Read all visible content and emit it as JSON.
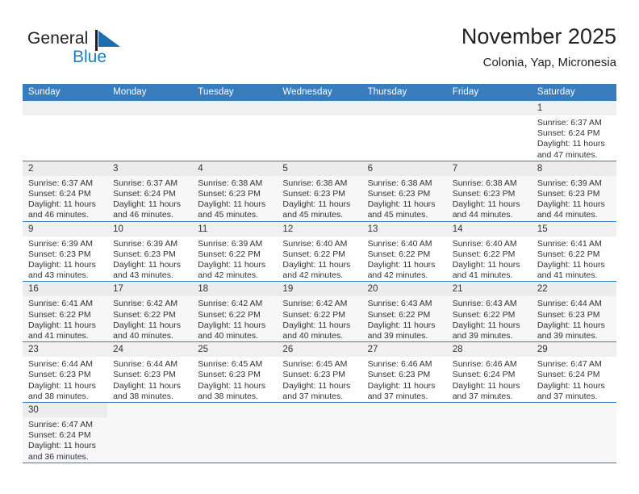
{
  "logo": {
    "word1": "General",
    "word2": "Blue",
    "flag_icon": "blue-triangle-flag",
    "color_dark": "#231f20",
    "color_blue": "#1b7fc4"
  },
  "header": {
    "title": "November 2025",
    "subtitle": "Colonia, Yap, Micronesia"
  },
  "theme": {
    "header_bg": "#3a7dbe",
    "header_text": "#ffffff",
    "daynum_bg": "#f0f0f0",
    "row_alt_bg": "#f7f7f7",
    "grid_line": "#3a7dbe"
  },
  "weekday_headers": [
    "Sunday",
    "Monday",
    "Tuesday",
    "Wednesday",
    "Thursday",
    "Friday",
    "Saturday"
  ],
  "weeks": [
    [
      {
        "day": "",
        "empty": true
      },
      {
        "day": "",
        "empty": true
      },
      {
        "day": "",
        "empty": true
      },
      {
        "day": "",
        "empty": true
      },
      {
        "day": "",
        "empty": true
      },
      {
        "day": "",
        "empty": true
      },
      {
        "day": "1",
        "sunrise": "Sunrise: 6:37 AM",
        "sunset": "Sunset: 6:24 PM",
        "daylight1": "Daylight: 11 hours",
        "daylight2": "and 47 minutes."
      }
    ],
    [
      {
        "day": "2",
        "sunrise": "Sunrise: 6:37 AM",
        "sunset": "Sunset: 6:24 PM",
        "daylight1": "Daylight: 11 hours",
        "daylight2": "and 46 minutes."
      },
      {
        "day": "3",
        "sunrise": "Sunrise: 6:37 AM",
        "sunset": "Sunset: 6:24 PM",
        "daylight1": "Daylight: 11 hours",
        "daylight2": "and 46 minutes."
      },
      {
        "day": "4",
        "sunrise": "Sunrise: 6:38 AM",
        "sunset": "Sunset: 6:23 PM",
        "daylight1": "Daylight: 11 hours",
        "daylight2": "and 45 minutes."
      },
      {
        "day": "5",
        "sunrise": "Sunrise: 6:38 AM",
        "sunset": "Sunset: 6:23 PM",
        "daylight1": "Daylight: 11 hours",
        "daylight2": "and 45 minutes."
      },
      {
        "day": "6",
        "sunrise": "Sunrise: 6:38 AM",
        "sunset": "Sunset: 6:23 PM",
        "daylight1": "Daylight: 11 hours",
        "daylight2": "and 45 minutes."
      },
      {
        "day": "7",
        "sunrise": "Sunrise: 6:38 AM",
        "sunset": "Sunset: 6:23 PM",
        "daylight1": "Daylight: 11 hours",
        "daylight2": "and 44 minutes."
      },
      {
        "day": "8",
        "sunrise": "Sunrise: 6:39 AM",
        "sunset": "Sunset: 6:23 PM",
        "daylight1": "Daylight: 11 hours",
        "daylight2": "and 44 minutes."
      }
    ],
    [
      {
        "day": "9",
        "sunrise": "Sunrise: 6:39 AM",
        "sunset": "Sunset: 6:23 PM",
        "daylight1": "Daylight: 11 hours",
        "daylight2": "and 43 minutes."
      },
      {
        "day": "10",
        "sunrise": "Sunrise: 6:39 AM",
        "sunset": "Sunset: 6:23 PM",
        "daylight1": "Daylight: 11 hours",
        "daylight2": "and 43 minutes."
      },
      {
        "day": "11",
        "sunrise": "Sunrise: 6:39 AM",
        "sunset": "Sunset: 6:22 PM",
        "daylight1": "Daylight: 11 hours",
        "daylight2": "and 42 minutes."
      },
      {
        "day": "12",
        "sunrise": "Sunrise: 6:40 AM",
        "sunset": "Sunset: 6:22 PM",
        "daylight1": "Daylight: 11 hours",
        "daylight2": "and 42 minutes."
      },
      {
        "day": "13",
        "sunrise": "Sunrise: 6:40 AM",
        "sunset": "Sunset: 6:22 PM",
        "daylight1": "Daylight: 11 hours",
        "daylight2": "and 42 minutes."
      },
      {
        "day": "14",
        "sunrise": "Sunrise: 6:40 AM",
        "sunset": "Sunset: 6:22 PM",
        "daylight1": "Daylight: 11 hours",
        "daylight2": "and 41 minutes."
      },
      {
        "day": "15",
        "sunrise": "Sunrise: 6:41 AM",
        "sunset": "Sunset: 6:22 PM",
        "daylight1": "Daylight: 11 hours",
        "daylight2": "and 41 minutes."
      }
    ],
    [
      {
        "day": "16",
        "sunrise": "Sunrise: 6:41 AM",
        "sunset": "Sunset: 6:22 PM",
        "daylight1": "Daylight: 11 hours",
        "daylight2": "and 41 minutes."
      },
      {
        "day": "17",
        "sunrise": "Sunrise: 6:42 AM",
        "sunset": "Sunset: 6:22 PM",
        "daylight1": "Daylight: 11 hours",
        "daylight2": "and 40 minutes."
      },
      {
        "day": "18",
        "sunrise": "Sunrise: 6:42 AM",
        "sunset": "Sunset: 6:22 PM",
        "daylight1": "Daylight: 11 hours",
        "daylight2": "and 40 minutes."
      },
      {
        "day": "19",
        "sunrise": "Sunrise: 6:42 AM",
        "sunset": "Sunset: 6:22 PM",
        "daylight1": "Daylight: 11 hours",
        "daylight2": "and 40 minutes."
      },
      {
        "day": "20",
        "sunrise": "Sunrise: 6:43 AM",
        "sunset": "Sunset: 6:22 PM",
        "daylight1": "Daylight: 11 hours",
        "daylight2": "and 39 minutes."
      },
      {
        "day": "21",
        "sunrise": "Sunrise: 6:43 AM",
        "sunset": "Sunset: 6:22 PM",
        "daylight1": "Daylight: 11 hours",
        "daylight2": "and 39 minutes."
      },
      {
        "day": "22",
        "sunrise": "Sunrise: 6:44 AM",
        "sunset": "Sunset: 6:23 PM",
        "daylight1": "Daylight: 11 hours",
        "daylight2": "and 39 minutes."
      }
    ],
    [
      {
        "day": "23",
        "sunrise": "Sunrise: 6:44 AM",
        "sunset": "Sunset: 6:23 PM",
        "daylight1": "Daylight: 11 hours",
        "daylight2": "and 38 minutes."
      },
      {
        "day": "24",
        "sunrise": "Sunrise: 6:44 AM",
        "sunset": "Sunset: 6:23 PM",
        "daylight1": "Daylight: 11 hours",
        "daylight2": "and 38 minutes."
      },
      {
        "day": "25",
        "sunrise": "Sunrise: 6:45 AM",
        "sunset": "Sunset: 6:23 PM",
        "daylight1": "Daylight: 11 hours",
        "daylight2": "and 38 minutes."
      },
      {
        "day": "26",
        "sunrise": "Sunrise: 6:45 AM",
        "sunset": "Sunset: 6:23 PM",
        "daylight1": "Daylight: 11 hours",
        "daylight2": "and 37 minutes."
      },
      {
        "day": "27",
        "sunrise": "Sunrise: 6:46 AM",
        "sunset": "Sunset: 6:23 PM",
        "daylight1": "Daylight: 11 hours",
        "daylight2": "and 37 minutes."
      },
      {
        "day": "28",
        "sunrise": "Sunrise: 6:46 AM",
        "sunset": "Sunset: 6:24 PM",
        "daylight1": "Daylight: 11 hours",
        "daylight2": "and 37 minutes."
      },
      {
        "day": "29",
        "sunrise": "Sunrise: 6:47 AM",
        "sunset": "Sunset: 6:24 PM",
        "daylight1": "Daylight: 11 hours",
        "daylight2": "and 37 minutes."
      }
    ],
    [
      {
        "day": "30",
        "sunrise": "Sunrise: 6:47 AM",
        "sunset": "Sunset: 6:24 PM",
        "daylight1": "Daylight: 11 hours",
        "daylight2": "and 36 minutes."
      },
      {
        "day": "",
        "empty": true,
        "blank": true
      },
      {
        "day": "",
        "empty": true,
        "blank": true
      },
      {
        "day": "",
        "empty": true,
        "blank": true
      },
      {
        "day": "",
        "empty": true,
        "blank": true
      },
      {
        "day": "",
        "empty": true,
        "blank": true
      },
      {
        "day": "",
        "empty": true,
        "blank": true
      }
    ]
  ]
}
